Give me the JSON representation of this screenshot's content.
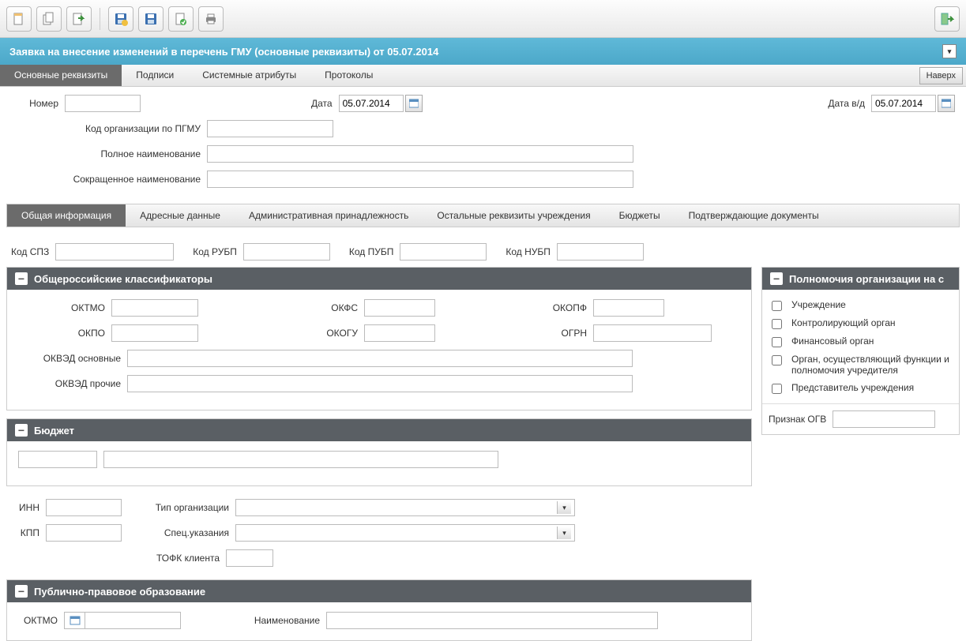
{
  "toolbar_icons": [
    "doc-new",
    "doc-copy",
    "doc-export",
    "save-partial",
    "save",
    "doc-approve",
    "print",
    "exit"
  ],
  "title": "Заявка на внесение изменений в перечень ГМУ (основные реквизиты) от 05.07.2014",
  "main_tabs": [
    "Основные реквизиты",
    "Подписи",
    "Системные атрибуты",
    "Протоколы"
  ],
  "up_button": "Наверх",
  "header_form": {
    "number_label": "Номер",
    "number_value": "",
    "date_label": "Дата",
    "date_value": "05.07.2014",
    "vd_date_label": "Дата в/д",
    "vd_date_value": "05.07.2014",
    "org_code_label": "Код организации по ПГМУ",
    "org_code_value": "",
    "full_name_label": "Полное наименование",
    "full_name_value": "",
    "short_name_label": "Сокращенное наименование",
    "short_name_value": ""
  },
  "sub_tabs": [
    "Общая информация",
    "Адресные данные",
    "Административная принадлежность",
    "Остальные реквизиты учреждения",
    "Бюджеты",
    "Подтверждающие документы"
  ],
  "codes": {
    "spz_label": "Код СПЗ",
    "spz_value": "",
    "rubp_label": "Код РУБП",
    "rubp_value": "",
    "pubp_label": "Код ПУБП",
    "pubp_value": "",
    "nubp_label": "Код НУБП",
    "nubp_value": ""
  },
  "classifiers": {
    "title": "Общероссийские классификаторы",
    "oktmo_label": "ОКТМО",
    "oktmo_value": "",
    "okfs_label": "ОКФС",
    "okfs_value": "",
    "okopf_label": "ОКОПФ",
    "okopf_value": "",
    "okpo_label": "ОКПО",
    "okpo_value": "",
    "okogu_label": "ОКОГУ",
    "okogu_value": "",
    "ogrn_label": "ОГРН",
    "ogrn_value": "",
    "okved_main_label": "ОКВЭД основные",
    "okved_main_value": "",
    "okved_other_label": "ОКВЭД прочие",
    "okved_other_value": ""
  },
  "budget": {
    "title": "Бюджет",
    "v1": "",
    "v2": ""
  },
  "org_info": {
    "inn_label": "ИНН",
    "inn_value": "",
    "kpp_label": "КПП",
    "kpp_value": "",
    "org_type_label": "Тип организации",
    "org_type_value": "",
    "spec_label": "Спец.указания",
    "spec_value": "",
    "tofk_label": "ТОФК клиента",
    "tofk_value": ""
  },
  "ppo": {
    "title": "Публично-правовое образование",
    "oktmo_label": "ОКТМО",
    "oktmo_value": "",
    "name_label": "Наименование",
    "name_value": ""
  },
  "rights": {
    "title": "Полномочия организации на с",
    "items": [
      "Учреждение",
      "Контролирующий орган",
      "Финансовый орган",
      "Орган, осуществляющий функции и полномочия учредителя",
      "Представитель учреждения"
    ],
    "ogv_label": "Признак ОГВ",
    "ogv_value": ""
  }
}
